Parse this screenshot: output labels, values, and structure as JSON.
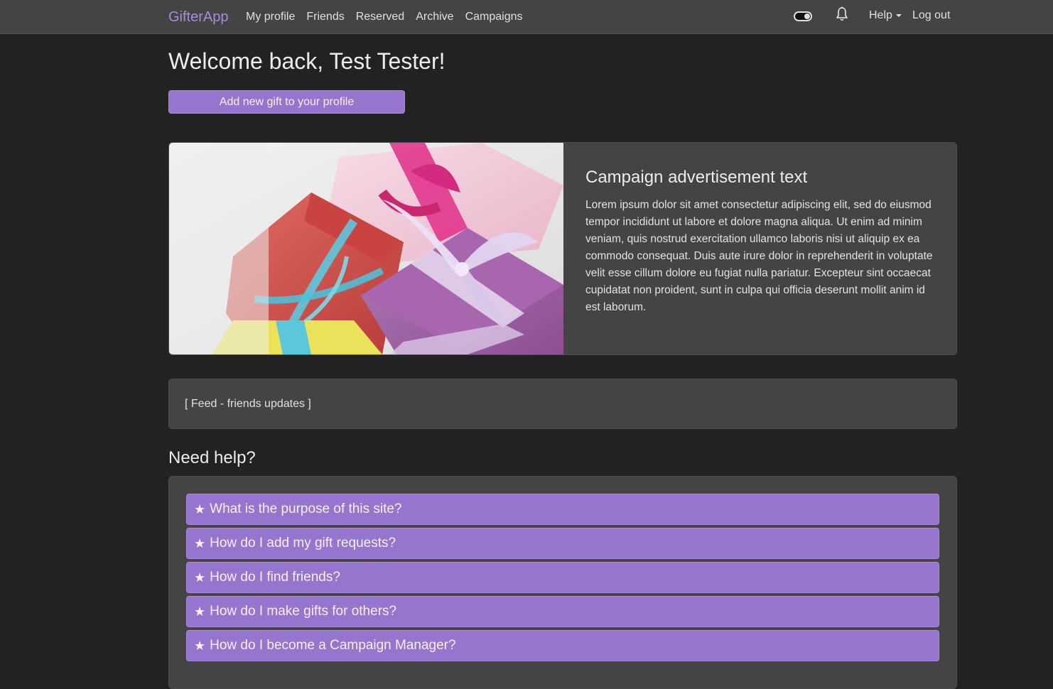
{
  "navbar": {
    "brand": "GifterApp",
    "links": [
      "My profile",
      "Friends",
      "Reserved",
      "Archive",
      "Campaigns"
    ],
    "help_label": "Help",
    "logout_label": "Log out",
    "theme_toggle_state": "on"
  },
  "main": {
    "welcome": "Welcome back, Test Tester!",
    "add_gift_label": "Add new gift to your profile"
  },
  "campaign": {
    "title": "Campaign advertisement text",
    "body": "Lorem ipsum dolor sit amet consectetur adipiscing elit, sed do eiusmod tempor incididunt ut labore et dolore magna aliqua. Ut enim ad minim veniam, quis nostrud exercitation ullamco laboris nisi ut aliquip ex ea commodo consequat. Duis aute irure dolor in reprehenderit in voluptate velit esse cillum dolore eu fugiat nulla pariatur. Excepteur sint occaecat cupidatat non proident, sunt in culpa qui officia deserunt mollit anim id est laborum."
  },
  "feed": {
    "text": "[ Feed - friends updates ]"
  },
  "help_section": {
    "title": "Need help?",
    "star_icon": "★",
    "questions": [
      "What is the purpose of this site?",
      "How do I add my gift requests?",
      "How do I find friends?",
      "How do I make gifts for others?",
      "How do I become a Campaign Manager?"
    ]
  },
  "colors": {
    "background": "#222222",
    "navbar": "#444444",
    "accent": "#9575cd",
    "brand": "#a98be0",
    "card": "#444444"
  }
}
